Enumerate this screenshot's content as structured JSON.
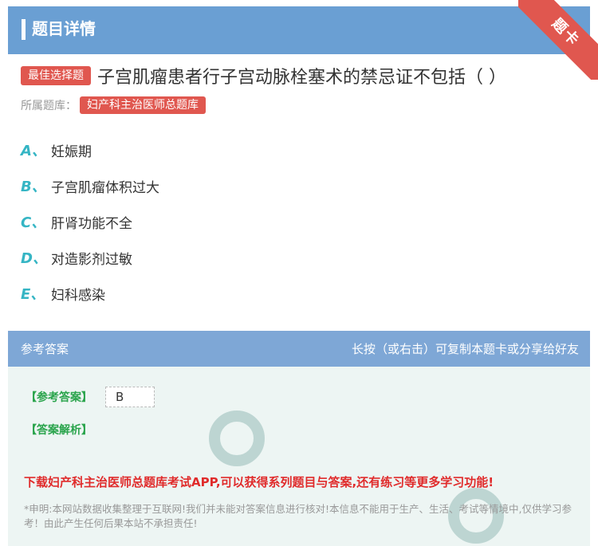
{
  "header": {
    "title": "题目详情",
    "corner_ribbon": "题卡"
  },
  "question": {
    "type_badge": "最佳选择题",
    "text": "子宫肌瘤患者行子宫动脉栓塞术的禁忌证不包括（ ）",
    "library_label": "所属题库：",
    "library_name": "妇产科主治医师总题库"
  },
  "options": [
    {
      "letter": "A、",
      "text": "妊娠期"
    },
    {
      "letter": "B、",
      "text": "子宫肌瘤体积过大"
    },
    {
      "letter": "C、",
      "text": "肝肾功能不全"
    },
    {
      "letter": "D、",
      "text": "对造影剂过敏"
    },
    {
      "letter": "E、",
      "text": "妇科感染"
    }
  ],
  "answer_section": {
    "title": "参考答案",
    "hint": "长按（或右击）可复制本题卡或分享给好友",
    "answer_label": "【参考答案】",
    "answer_value": "B",
    "analysis_label": "【答案解析】",
    "promo": "下载妇产科主治医师总题库考试APP,可以获得系列题目与答案,还有练习等更多学习功能!",
    "disclaimer": "*申明:本网站数据收集整理于互联网!我们并未能对答案信息进行核对!本信息不能用于生产、生活、考试等情境中,仅供学习参考！由此产生任何后果本站不承担责任!"
  },
  "colors": {
    "header": "#6a9fd3",
    "badge": "#e0574f",
    "option_letter": "#35b5c4",
    "answer_label": "#2aa44c",
    "promo": "#e02b2b"
  }
}
